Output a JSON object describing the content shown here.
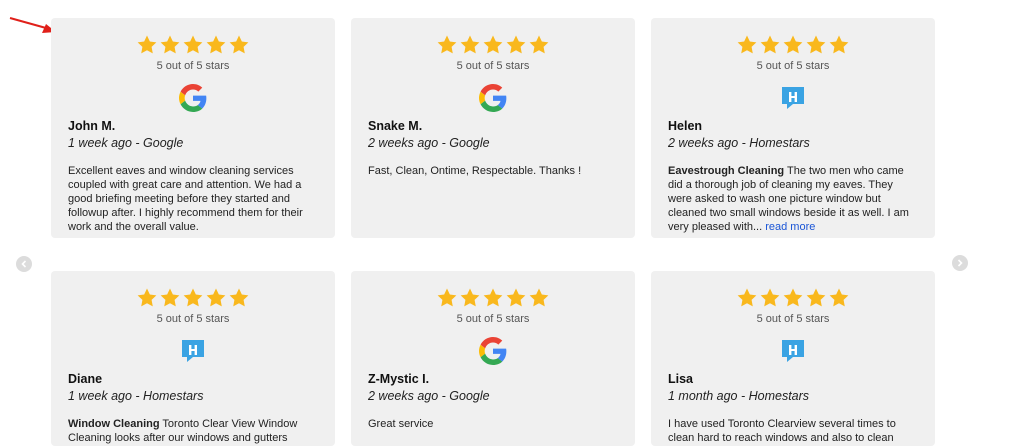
{
  "colors": {
    "star": "#F9B81D",
    "card_bg": "#f0f0f0",
    "link": "#1a55d6",
    "homestars": "#3aa3e3"
  },
  "reviews": [
    {
      "rating_text": "5 out of 5 stars",
      "source": "google",
      "reviewer": "John M.",
      "meta": "1 week ago - Google",
      "bold": "",
      "text": "Excellent eaves and window cleaning services coupled with great care and attention. We had a good briefing meeting before they started and followup after. I highly recommend them for their work and the overall value.",
      "more": ""
    },
    {
      "rating_text": "5 out of 5 stars",
      "source": "google",
      "reviewer": "Snake M.",
      "meta": "2 weeks ago - Google",
      "bold": "",
      "text": "Fast, Clean, Ontime, Respectable. Thanks !",
      "more": ""
    },
    {
      "rating_text": "5 out of 5 stars",
      "source": "homestars",
      "reviewer": "Helen",
      "meta": "2 weeks ago - Homestars",
      "bold": "Eavestrough Cleaning",
      "text": " The two men who came did a thorough job of cleaning my eaves. They were asked to wash one picture window but cleaned two small windows beside it as well. I am very pleased with... ",
      "more": "read more"
    },
    {
      "rating_text": "5 out of 5 stars",
      "source": "homestars",
      "reviewer": "Diane",
      "meta": "1 week ago - Homestars",
      "bold": "Window Cleaning",
      "text": " Toronto Clear View Window Cleaning looks after our windows and gutters",
      "more": ""
    },
    {
      "rating_text": "5 out of 5 stars",
      "source": "google",
      "reviewer": "Z-Mystic I.",
      "meta": "2 weeks ago - Google",
      "bold": "",
      "text": "Great service",
      "more": ""
    },
    {
      "rating_text": "5 out of 5 stars",
      "source": "homestars",
      "reviewer": "Lisa",
      "meta": "1 month ago - Homestars",
      "bold": "",
      "text": "I have used Toronto Clearview several times to clean hard to reach windows and also to clean",
      "more": ""
    }
  ]
}
